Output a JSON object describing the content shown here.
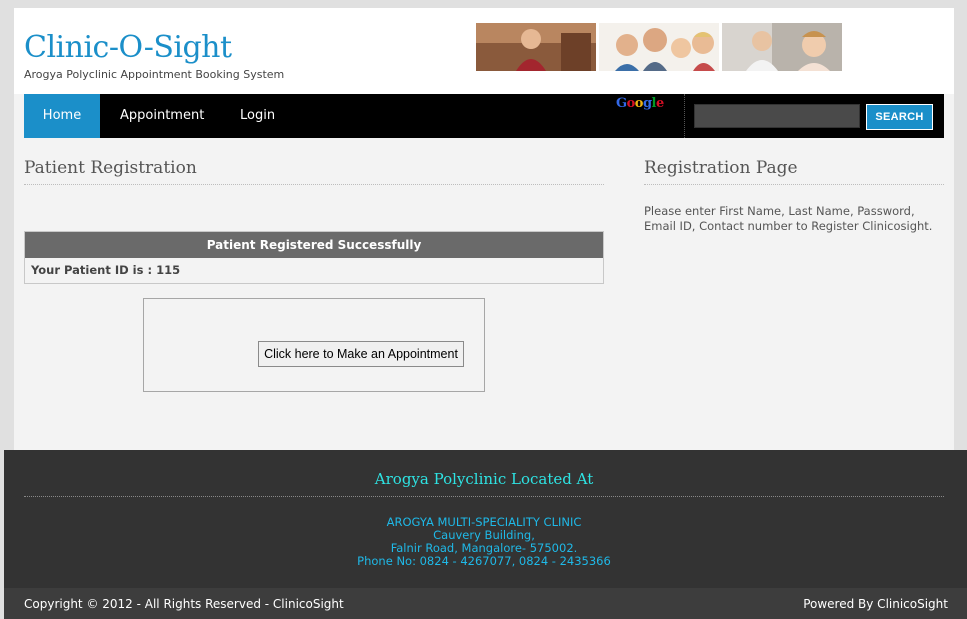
{
  "header": {
    "logo_title": "Clinic-O-Sight",
    "logo_subtitle": "Arogya Polyclinic Appointment Booking System"
  },
  "nav": {
    "items": [
      {
        "label": "Home",
        "active": true
      },
      {
        "label": "Appointment",
        "active": false
      },
      {
        "label": "Login",
        "active": false
      }
    ],
    "google_logo": "Google",
    "search_placeholder": "",
    "search_button": "SEARCH"
  },
  "main": {
    "title": "Patient Registration",
    "result_header": "Patient Registered Successfully",
    "result_row": "Your Patient ID is : 115",
    "appointment_button": "Click here to Make an Appointment"
  },
  "sidebar": {
    "title": "Registration Page",
    "text": "Please enter First Name, Last Name, Password, Email ID, Contact number to Register Clinicosight."
  },
  "footer": {
    "title": "Arogya Polyclinic Located At",
    "address_lines": [
      "AROGYA MULTI-SPECIALITY CLINIC",
      "Cauvery Building,",
      "Falnir Road, Mangalore- 575002.",
      "Phone No: 0824 - 4267077, 0824 - 2435366"
    ],
    "copyright": "Copyright © 2012 - All Rights Reserved - ClinicoSight",
    "powered_by": "Powered By ClinicoSight"
  },
  "colors": {
    "brand_blue": "#1b8fc9",
    "nav_bg": "#000000",
    "footer_bg": "#333333",
    "footer_accent": "#2ee3e3"
  }
}
